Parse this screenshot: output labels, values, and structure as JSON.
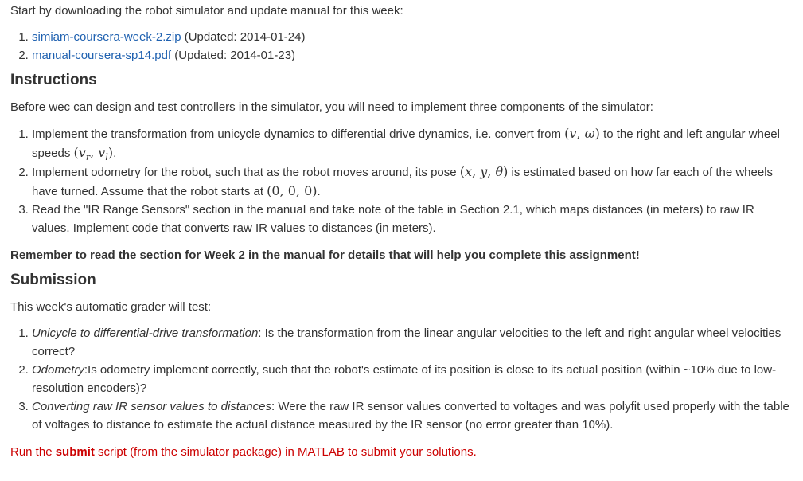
{
  "intro": "Start by downloading the robot simulator and update manual for this week:",
  "files": [
    {
      "link": "simiam-coursera-week-2.zip",
      "note": " (Updated: 2014-01-24)"
    },
    {
      "link": "manual-coursera-sp14.pdf",
      "note": " (Updated: 2014-01-23)"
    }
  ],
  "instructions": {
    "heading": "Instructions",
    "lead": "Before wec can design and test controllers in the simulator, you will need to implement three components of the simulator:",
    "item1_a": "Implement the transformation from unicycle dynamics to differential drive dynamics, i.e. convert from ",
    "item1_b": " to the right and left angular wheel speeds ",
    "item1_c": ".",
    "item2_a": "Implement odometry for the robot, such that as the robot moves around, its pose ",
    "item2_b": " is estimated based on how far each of the wheels have turned. Assume that the robot starts at ",
    "item2_c": ".",
    "item3": "Read the \"IR Range Sensors\" section in the manual and take note of the table in Section 2.1, which maps distances (in meters) to raw IR values. Implement code that converts raw IR values to distances (in meters).",
    "reminder": "Remember to read the section for Week 2 in the manual for details that will help you complete this assignment!"
  },
  "submission": {
    "heading": "Submission",
    "lead": "This week's automatic grader will test:",
    "items": [
      {
        "title": "Unicycle to differential-drive transformation",
        "text": ": Is the transformation from the linear angular velocities to the left and right angular wheel velocities correct?"
      },
      {
        "title": "Odometry",
        "text": ":Is odometry implement correctly, such that the robot's estimate of its position is close to its actual position (within ~10% due to low-resolution encoders)?"
      },
      {
        "title": "Converting raw IR sensor values to distances",
        "text": ": Were the raw IR sensor values converted to voltages and was polyfit used properly with the table of voltages to distance to estimate the actual distance measured by the IR sensor (no error greater than 10%)."
      }
    ],
    "footer_a": "Run the ",
    "footer_bold": "submit",
    "footer_b": " script (from the simulator package) in MATLAB to submit your solutions."
  },
  "colors": {
    "link": "#1f61b0",
    "footer": "#cc0000",
    "text": "#333333"
  }
}
